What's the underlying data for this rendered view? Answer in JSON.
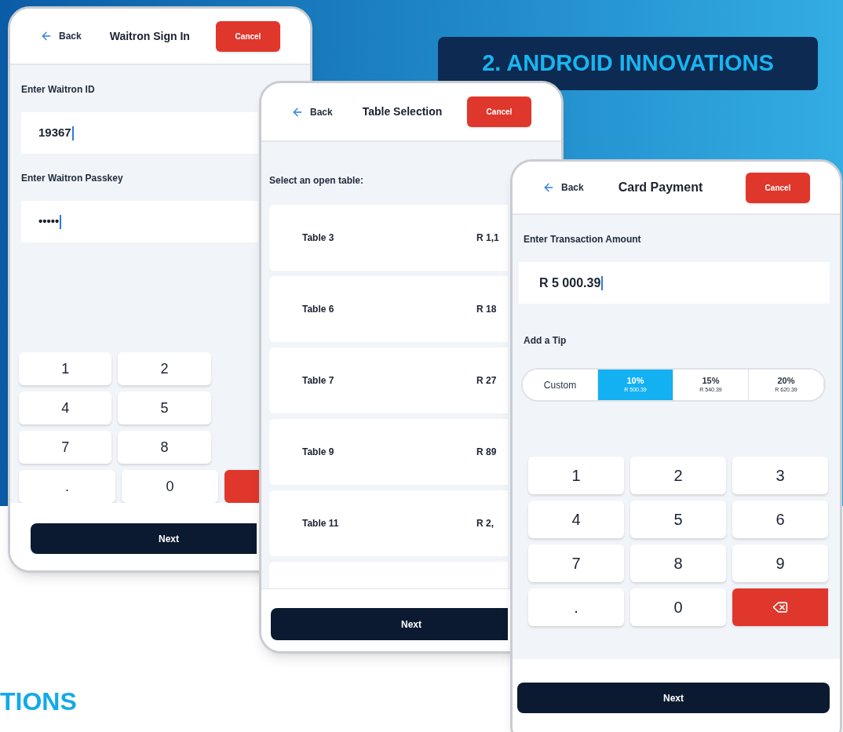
{
  "banner": {
    "title": "2. ANDROID INNOVATIONS"
  },
  "footer_heading": "TIONS",
  "screens": [
    {
      "kind": "sign_in",
      "back": "Back",
      "title": "Waitron Sign In",
      "cancel": "Cancel",
      "fields": [
        {
          "label": "Enter Waitron ID",
          "value": "19367"
        },
        {
          "label": "Enter Waitron Passkey",
          "value": "•••••"
        }
      ],
      "keypad": [
        [
          {
            "kind": "digit",
            "label": "1"
          },
          {
            "kind": "digit",
            "label": "2"
          }
        ],
        [
          {
            "kind": "digit",
            "label": "4"
          },
          {
            "kind": "digit",
            "label": "5"
          }
        ],
        [
          {
            "kind": "digit",
            "label": "7"
          },
          {
            "kind": "digit",
            "label": "8"
          }
        ],
        [
          {
            "kind": "digit",
            "label": "."
          },
          {
            "kind": "digit",
            "label": "0"
          },
          {
            "kind": "delete",
            "icon": false
          }
        ]
      ],
      "next": "Next"
    },
    {
      "kind": "table_list",
      "back": "Back",
      "title": "Table Selection",
      "cancel": "Cancel",
      "prompt": "Select an open table:",
      "rows": [
        {
          "name": "Table 3",
          "amount": "R 1,1"
        },
        {
          "name": "Table 6",
          "amount": "R 18"
        },
        {
          "name": "Table 7",
          "amount": "R 27"
        },
        {
          "name": "Table 9",
          "amount": "R 89"
        },
        {
          "name": "Table 11",
          "amount": "R 2,"
        }
      ],
      "next": "Next"
    },
    {
      "kind": "payment",
      "back": "Back",
      "title": "Card Payment",
      "cancel": "Cancel",
      "amount_label": "Enter Transaction Amount",
      "amount": "R 5 000.39",
      "tip_label": "Add a Tip",
      "tips": [
        {
          "label": "Custom",
          "selected": false
        },
        {
          "label": "10%",
          "amount": "R 500.39",
          "selected": true
        },
        {
          "label": "15%",
          "amount": "R 540.39",
          "selected": false
        },
        {
          "label": "20%",
          "amount": "R 620.39",
          "selected": false
        }
      ],
      "keypad": [
        [
          {
            "kind": "digit",
            "label": "1"
          },
          {
            "kind": "digit",
            "label": "2"
          },
          {
            "kind": "digit",
            "label": "3"
          }
        ],
        [
          {
            "kind": "digit",
            "label": "4"
          },
          {
            "kind": "digit",
            "label": "5"
          },
          {
            "kind": "digit",
            "label": "6"
          }
        ],
        [
          {
            "kind": "digit",
            "label": "7"
          },
          {
            "kind": "digit",
            "label": "8"
          },
          {
            "kind": "digit",
            "label": "9"
          }
        ],
        [
          {
            "kind": "digit",
            "label": "."
          },
          {
            "kind": "digit",
            "label": "0"
          },
          {
            "kind": "delete",
            "icon": true
          }
        ]
      ],
      "next": "Next"
    }
  ]
}
